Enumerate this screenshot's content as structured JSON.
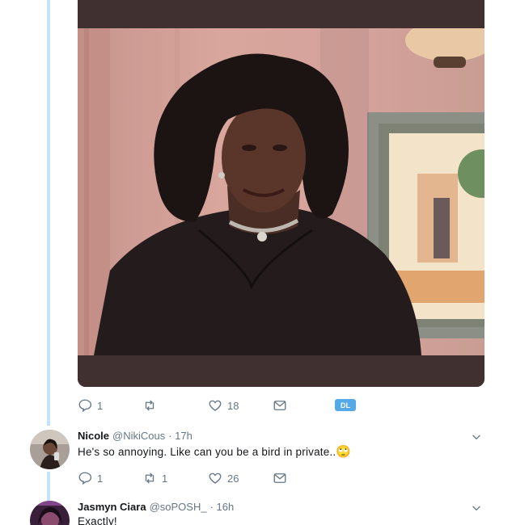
{
  "media": {
    "colors": {
      "bar": "#40302f",
      "wall": "#d4a29b"
    }
  },
  "tweet_actions": {
    "replies": "1",
    "retweets": "",
    "likes": "18",
    "badge": "DL"
  },
  "replies": [
    {
      "name": "Nicole",
      "handle": "@NikiCous",
      "time": "· 17h",
      "text": "He's so annoying. Like can you be a bird in private..",
      "emoji": "🙄",
      "actions": {
        "replies": "1",
        "retweets": "1",
        "likes": "26"
      }
    },
    {
      "name": "Jasmyn Ciara",
      "handle": "@soPOSH_",
      "time": "· 16h",
      "text": "Exactly!"
    }
  ],
  "icons": {
    "reply": "reply-icon",
    "retweet": "retweet-icon",
    "like": "heart-icon",
    "dm": "envelope-icon",
    "more": "chevron-down-icon"
  },
  "colors": {
    "accent": "#1da1f2",
    "muted": "#657786",
    "thread": "#c4e3f9",
    "badge": "#55a9e6"
  }
}
